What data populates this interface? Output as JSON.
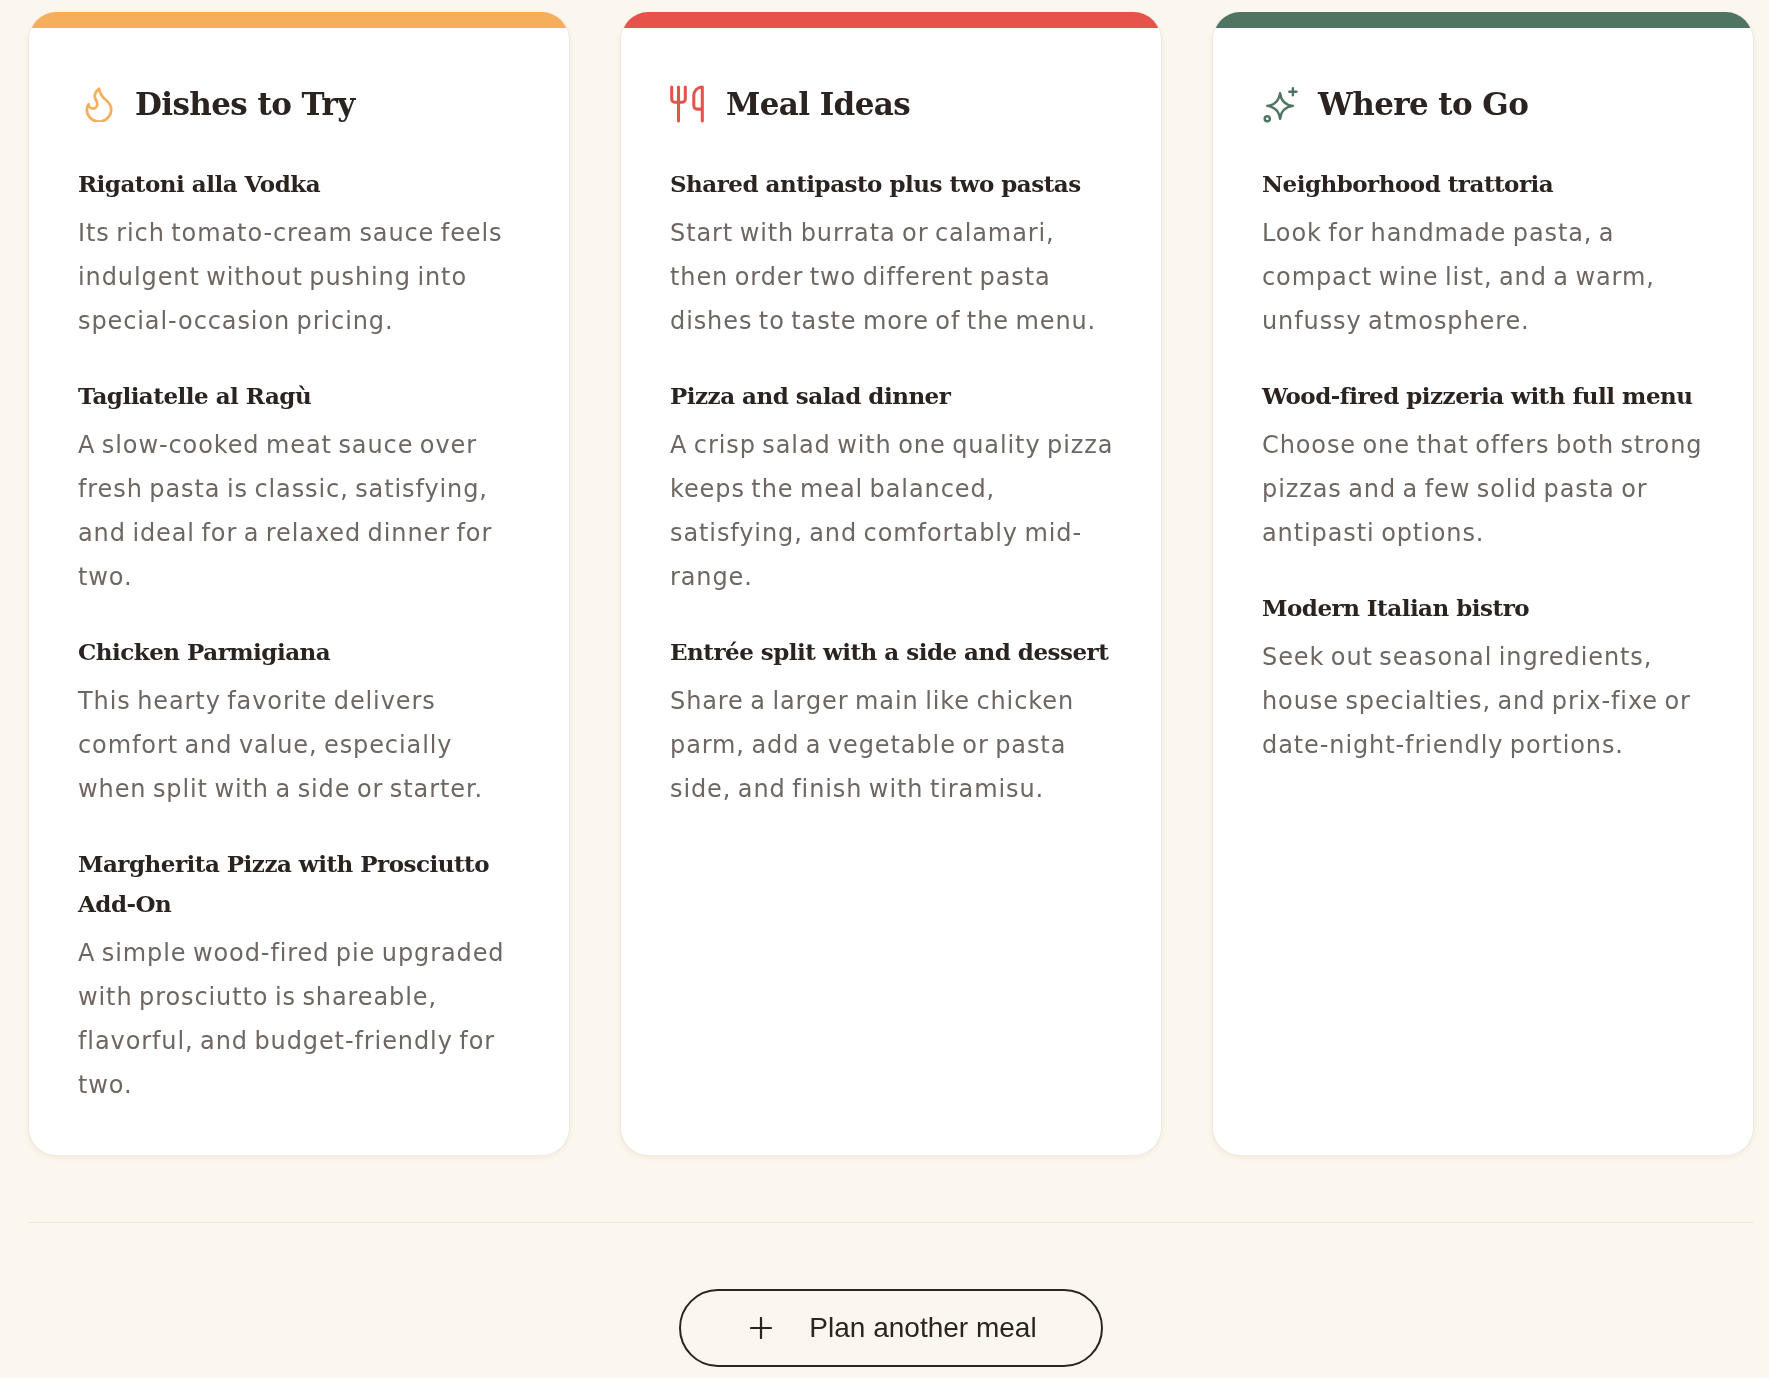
{
  "columns": [
    {
      "title": "Dishes to Try",
      "color": "#f5ae5c",
      "items": [
        {
          "name": "Rigatoni alla Vodka",
          "description": "Its rich tomato-cream sauce feels indulgent without pushing into special-occasion pricing."
        },
        {
          "name": "Tagliatelle al Ragù",
          "description": "A slow-cooked meat sauce over fresh pasta is classic, satisfying, and ideal for a relaxed dinner for two."
        },
        {
          "name": "Chicken Parmigiana",
          "description": "This hearty favorite delivers comfort and value, especially when split with a side or starter."
        },
        {
          "name": "Margherita Pizza with Prosciutto Add-On",
          "description": "A simple wood-fired pie upgraded with prosciutto is shareable, flavorful, and budget-friendly for two."
        }
      ]
    },
    {
      "title": "Meal Ideas",
      "color": "#e5534b",
      "items": [
        {
          "name": "Shared antipasto plus two pastas",
          "description": "Start with burrata or calamari, then order two different pasta dishes to taste more of the menu."
        },
        {
          "name": "Pizza and salad dinner",
          "description": "A crisp salad with one quality pizza keeps the meal balanced, satisfying, and comfortably mid-range."
        },
        {
          "name": "Entrée split with a side and dessert",
          "description": "Share a larger main like chicken parm, add a vegetable or pasta side, and finish with tiramisu."
        }
      ]
    },
    {
      "title": "Where to Go",
      "color": "#4f7562",
      "items": [
        {
          "name": "Neighborhood trattoria",
          "description": "Look for handmade pasta, a compact wine list, and a warm, unfussy atmosphere."
        },
        {
          "name": "Wood-fired pizzeria with full menu",
          "description": "Choose one that offers both strong pizzas and a few solid pasta or antipasti options."
        },
        {
          "name": "Modern Italian bistro",
          "description": "Seek out seasonal ingredients, house specialties, and prix-fixe or date-night-friendly portions."
        }
      ]
    }
  ],
  "action_button": {
    "label": "Plan another meal"
  }
}
